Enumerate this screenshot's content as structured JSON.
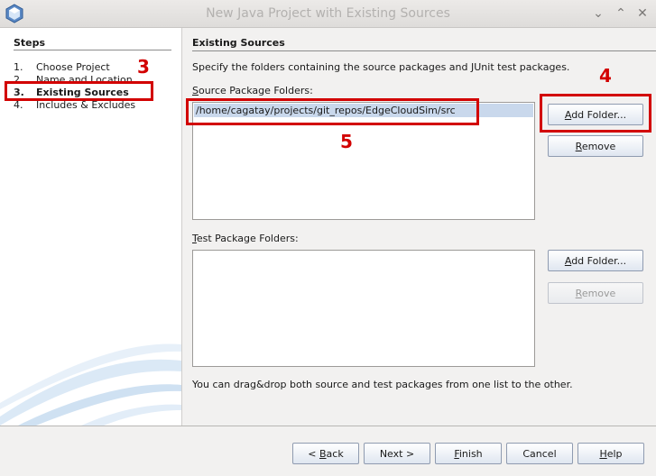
{
  "window": {
    "title": "New Java Project with Existing Sources"
  },
  "steps": {
    "heading": "Steps",
    "items": [
      {
        "num": "1.",
        "label": "Choose Project"
      },
      {
        "num": "2.",
        "label": "Name and Location"
      },
      {
        "num": "3.",
        "label": "Existing Sources"
      },
      {
        "num": "4.",
        "label": "Includes & Excludes"
      }
    ],
    "active_index": 2
  },
  "content": {
    "heading": "Existing Sources",
    "description": "Specify the folders containing the source packages and JUnit test packages.",
    "source": {
      "label_mnemonic": "S",
      "label_rest": "ource Package Folders:",
      "items": [
        "/home/cagatay/projects/git_repos/EdgeCloudSim/src"
      ],
      "add_mnemonic": "A",
      "add_rest": "dd Folder...",
      "remove_mnemonic": "R",
      "remove_rest": "emove"
    },
    "test": {
      "label_mnemonic": "T",
      "label_rest": "est Package Folders:",
      "items": [],
      "add_mnemonic": "A",
      "add_rest": "dd Folder...",
      "remove_mnemonic": "R",
      "remove_rest": "emove",
      "remove_disabled": true
    },
    "hint": "You can drag&drop both source and test packages from one list to the other."
  },
  "footer": {
    "back_pre": "< ",
    "back_mnemonic": "B",
    "back_rest": "ack",
    "next": "Next >",
    "finish_mnemonic": "F",
    "finish_rest": "inish",
    "cancel": "Cancel",
    "help_mnemonic": "H",
    "help_rest": "elp"
  },
  "annotations": [
    "3",
    "4",
    "5"
  ],
  "colors": {
    "annotation": "#d20000",
    "selection": "#c9d8ec"
  }
}
